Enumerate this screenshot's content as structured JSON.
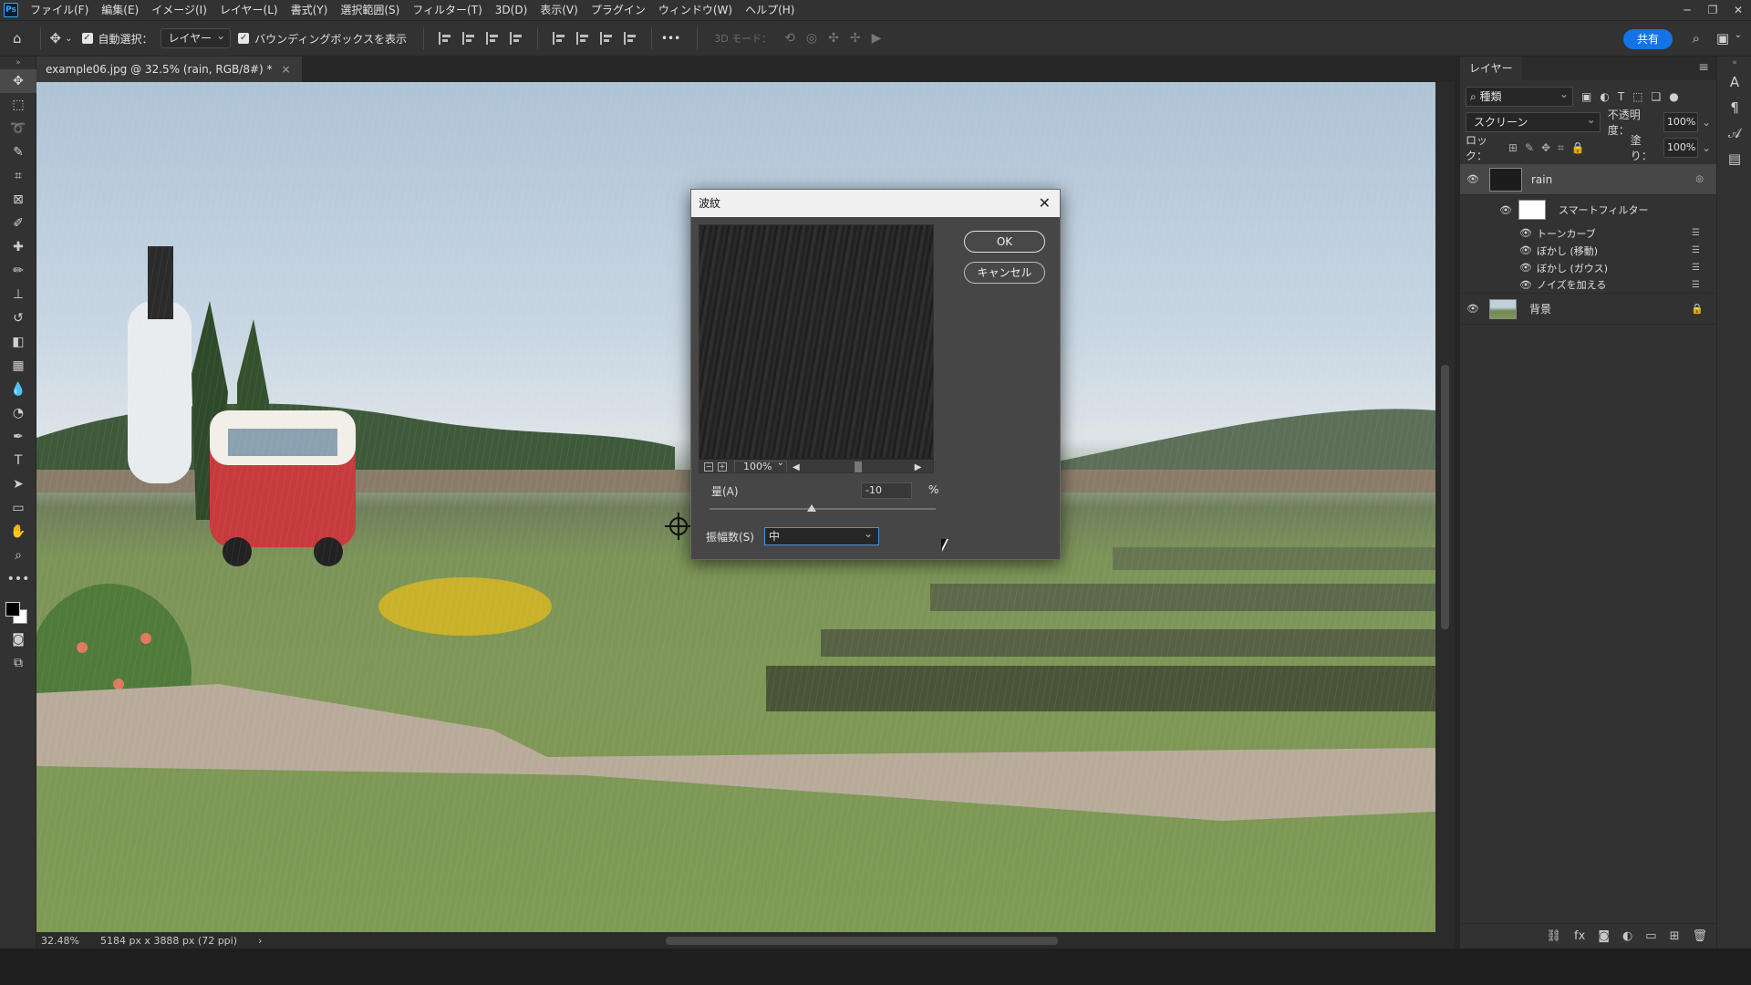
{
  "app": {
    "logo": "Ps",
    "menu": [
      "ファイル(F)",
      "編集(E)",
      "イメージ(I)",
      "レイヤー(L)",
      "書式(Y)",
      "選択範囲(S)",
      "フィルター(T)",
      "3D(D)",
      "表示(V)",
      "プラグイン",
      "ウィンドウ(W)",
      "ヘルプ(H)"
    ],
    "window_controls": [
      "─",
      "❐",
      "✕"
    ]
  },
  "options_bar": {
    "auto_select_label": "自動選択：",
    "auto_select_target": "レイヤー",
    "bounding_box_label": "バウンディングボックスを表示",
    "more": "•••",
    "mode_3d_label": "3D モード：",
    "share_label": "共有"
  },
  "document": {
    "tab_title": "example06.jpg @ 32.5% (rain, RGB/8#) *",
    "tab_close": "×",
    "zoom": "32.48%",
    "dimensions": "5184 px x 3888 px (72 ppi)",
    "status_arrow": "›"
  },
  "layers_panel": {
    "tab_label": "レイヤー",
    "filter_kind": "種類",
    "blend_mode": "スクリーン",
    "opacity_label": "不透明度：",
    "opacity_value": "100%",
    "lock_label": "ロック：",
    "fill_label": "塗り：",
    "fill_value": "100%",
    "layers": [
      {
        "name": "rain",
        "selected": true
      },
      {
        "name": "スマートフィルター"
      },
      {
        "name": "背景",
        "locked": true
      }
    ],
    "smart_filters": [
      "トーンカーブ",
      "ぼかし (移動)",
      "ぼかし (ガウス)",
      "ノイズを加える"
    ]
  },
  "dialog": {
    "title": "波紋",
    "ok_label": "OK",
    "cancel_label": "キャンセル",
    "preview_zoom": "100%",
    "amount_label": "量(A)",
    "amount_value": "-10",
    "amount_unit": "%",
    "amount_slider_fraction": 0.45,
    "size_label": "振幅数(S)",
    "size_value": "中"
  },
  "colors": {
    "accent": "#1473e6",
    "panel_bg": "#323232",
    "foreground_swatch": "#000000",
    "background_swatch": "#ffffff"
  }
}
